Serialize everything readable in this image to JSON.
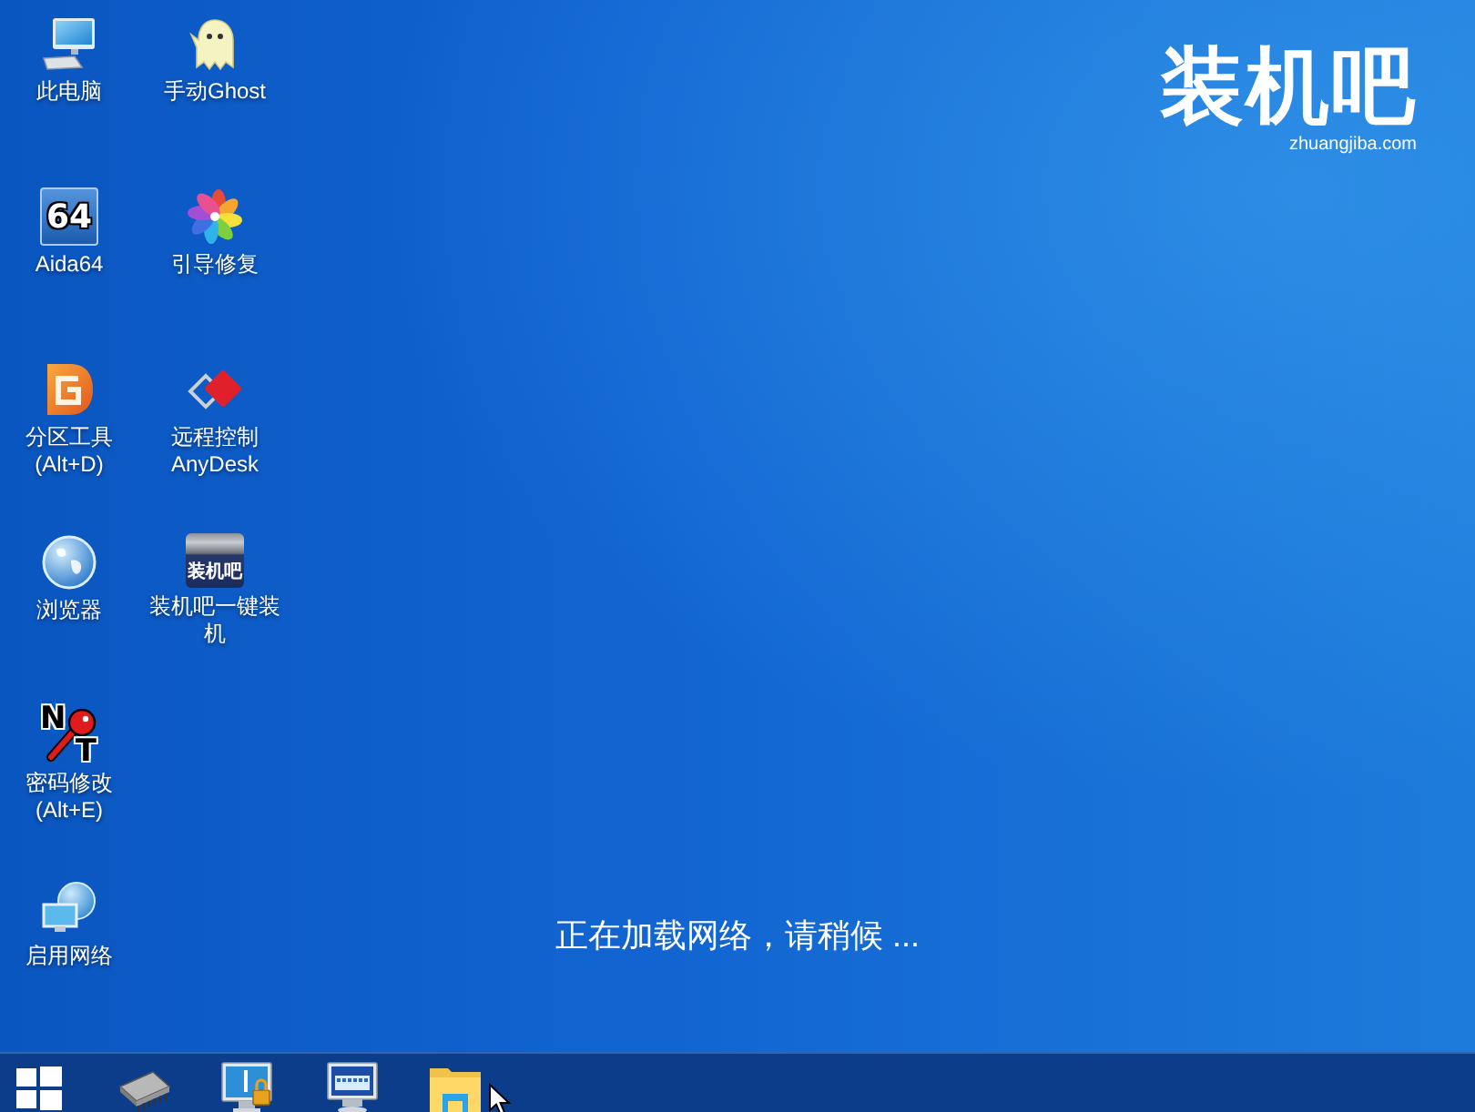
{
  "desktop_icons": [
    {
      "kind": "computer",
      "label": "此电脑"
    },
    {
      "kind": "aida",
      "label": "Aida64",
      "badge": "64"
    },
    {
      "kind": "partition",
      "label": "分区工具(Alt+D)"
    },
    {
      "kind": "globe",
      "label": "浏览器"
    },
    {
      "kind": "key",
      "label": "密码修改(Alt+E)",
      "badge_letters": [
        "N",
        "T"
      ]
    },
    {
      "kind": "network",
      "label": "启用网络"
    },
    {
      "kind": "ghost",
      "label": "手动Ghost"
    },
    {
      "kind": "pinwheel",
      "label": "引导修复"
    },
    {
      "kind": "anydesk",
      "label": "远程控制AnyDesk"
    },
    {
      "kind": "usb",
      "label": "装机吧一键装机",
      "badge": "装机吧"
    }
  ],
  "wallpaper_logo": {
    "name": "装机吧",
    "url": "zhuangjiba.com"
  },
  "status_message": "正在加载网络，请稍候 ...",
  "taskbar": {
    "items": [
      {
        "kind": "start"
      },
      {
        "kind": "chip"
      },
      {
        "kind": "remote-desktop"
      },
      {
        "kind": "keyboard-monitor"
      },
      {
        "kind": "folder"
      }
    ]
  }
}
